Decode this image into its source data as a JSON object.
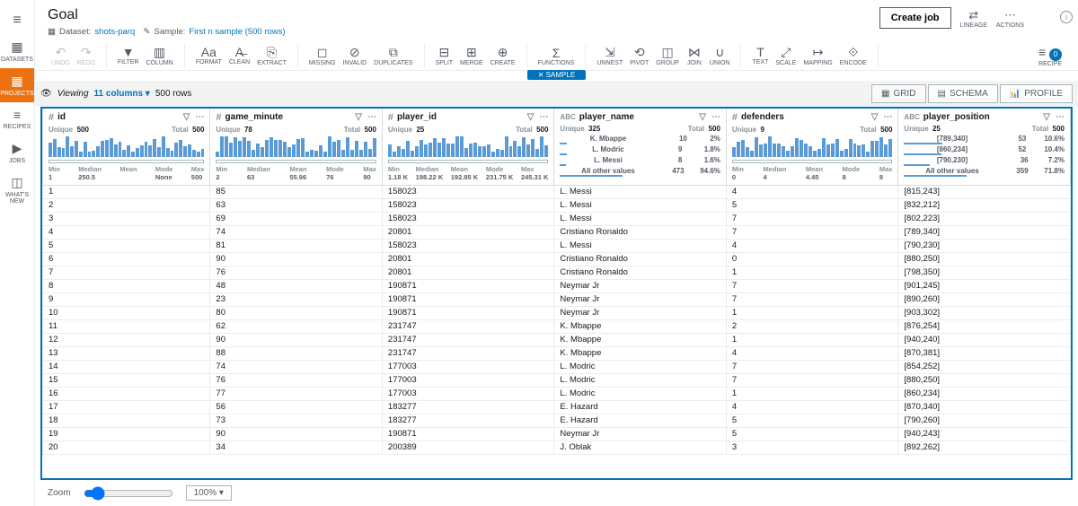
{
  "nav": {
    "items": [
      {
        "label": "DATASETS",
        "icon": "▦"
      },
      {
        "label": "PROJECTS",
        "icon": "▦"
      },
      {
        "label": "RECIPES",
        "icon": "≡"
      },
      {
        "label": "JOBS",
        "icon": "▶"
      },
      {
        "label": "WHAT'S NEW",
        "icon": "◫"
      }
    ]
  },
  "header": {
    "title": "Goal",
    "dataset_label": "Dataset:",
    "dataset_link": "shots-parq",
    "sample_label": "Sample:",
    "sample_link": "First n sample (500 rows)",
    "create_job": "Create job",
    "lineage": "LINEAGE",
    "actions": "ACTIONS"
  },
  "toolbar": {
    "undo": "UNDO",
    "redo": "REDO",
    "filter": "FILTER",
    "column": "COLUMN",
    "format": "FORMAT",
    "clean": "CLEAN",
    "extract": "EXTRACT",
    "missing": "MISSING",
    "invalid": "INVALID",
    "duplicates": "DUPLICATES",
    "split": "SPLIT",
    "merge": "MERGE",
    "create": "CREATE",
    "functions": "FUNCTIONS",
    "unnest": "UNNEST",
    "pivot": "PIVOT",
    "group": "GROUP",
    "join": "JOIN",
    "union": "UNION",
    "text": "TEXT",
    "scale": "SCALE",
    "mapping": "MAPPING",
    "encode": "ENCODE",
    "recipe": "RECIPE",
    "recipe_count": "0"
  },
  "sample_badge": "✕ SAMPLE",
  "viewrow": {
    "viewing": "Viewing",
    "columns": "11 columns",
    "rows": "500 rows",
    "grid": "GRID",
    "schema": "SCHEMA",
    "profile": "PROFILE"
  },
  "columns": {
    "id": {
      "name": "id",
      "type": "#",
      "unique": "500",
      "total": "500",
      "stats": {
        "Min": "1",
        "Median": "250.5",
        "Mean": "",
        "Mode": "None",
        "Max": "500"
      }
    },
    "game_minute": {
      "name": "game_minute",
      "type": "#",
      "unique": "78",
      "total": "500",
      "stats": {
        "Min": "2",
        "Median": "63",
        "Mean": "55.96",
        "Mode": "76",
        "Max": "90"
      }
    },
    "player_id": {
      "name": "player_id",
      "type": "#",
      "unique": "25",
      "total": "500",
      "stats": {
        "Min": "1.18 K",
        "Median": "198.22 K",
        "Mean": "192.85 K",
        "Mode": "231.75 K",
        "Max": "245.31 K"
      }
    },
    "player_name": {
      "name": "player_name",
      "type": "ABC",
      "unique": "325",
      "total": "500",
      "top": [
        {
          "v": "K. Mbappe",
          "c": "10",
          "p": "2%"
        },
        {
          "v": "L. Modric",
          "c": "9",
          "p": "1.8%"
        },
        {
          "v": "L. Messi",
          "c": "8",
          "p": "1.6%"
        },
        {
          "v": "All other values",
          "c": "473",
          "p": "94.6%"
        }
      ]
    },
    "defenders": {
      "name": "defenders",
      "type": "#",
      "unique": "9",
      "total": "500",
      "stats": {
        "Min": "0",
        "Median": "4",
        "Mean": "4.45",
        "Mode": "8",
        "Max": "8"
      }
    },
    "player_position": {
      "name": "player_position",
      "type": "ABC",
      "unique": "25",
      "total": "500",
      "top": [
        {
          "v": "[789,340]",
          "c": "53",
          "p": "10.6%"
        },
        {
          "v": "[860,234]",
          "c": "52",
          "p": "10.4%"
        },
        {
          "v": "[790,230]",
          "c": "36",
          "p": "7.2%"
        },
        {
          "v": "All other values",
          "c": "359",
          "p": "71.8%"
        }
      ]
    }
  },
  "labels": {
    "unique": "Unique",
    "total": "Total"
  },
  "rows": [
    {
      "id": "1",
      "gm": "85",
      "pid": "158023",
      "pn": "L. Messi",
      "def": "4",
      "pp": "[815,243]"
    },
    {
      "id": "2",
      "gm": "63",
      "pid": "158023",
      "pn": "L. Messi",
      "def": "5",
      "pp": "[832,212]"
    },
    {
      "id": "3",
      "gm": "69",
      "pid": "158023",
      "pn": "L. Messi",
      "def": "7",
      "pp": "[802,223]"
    },
    {
      "id": "4",
      "gm": "74",
      "pid": "20801",
      "pn": "Cristiano Ronaldo",
      "def": "7",
      "pp": "[789,340]"
    },
    {
      "id": "5",
      "gm": "81",
      "pid": "158023",
      "pn": "L. Messi",
      "def": "4",
      "pp": "[790,230]"
    },
    {
      "id": "6",
      "gm": "90",
      "pid": "20801",
      "pn": "Cristiano Ronaldo",
      "def": "0",
      "pp": "[880,250]"
    },
    {
      "id": "7",
      "gm": "76",
      "pid": "20801",
      "pn": "Cristiano Ronaldo",
      "def": "1",
      "pp": "[798,350]"
    },
    {
      "id": "8",
      "gm": "48",
      "pid": "190871",
      "pn": "Neymar Jr",
      "def": "7",
      "pp": "[901,245]"
    },
    {
      "id": "9",
      "gm": "23",
      "pid": "190871",
      "pn": "Neymar Jr",
      "def": "7",
      "pp": "[890,260]"
    },
    {
      "id": "10",
      "gm": "80",
      "pid": "190871",
      "pn": "Neymar Jr",
      "def": "1",
      "pp": "[903,302]"
    },
    {
      "id": "11",
      "gm": "62",
      "pid": "231747",
      "pn": "K. Mbappe",
      "def": "2",
      "pp": "[876,254]"
    },
    {
      "id": "12",
      "gm": "90",
      "pid": "231747",
      "pn": "K. Mbappe",
      "def": "1",
      "pp": "[940,240]"
    },
    {
      "id": "13",
      "gm": "88",
      "pid": "231747",
      "pn": "K. Mbappe",
      "def": "4",
      "pp": "[870,381]"
    },
    {
      "id": "14",
      "gm": "74",
      "pid": "177003",
      "pn": "L. Modric",
      "def": "7",
      "pp": "[854,252]"
    },
    {
      "id": "15",
      "gm": "76",
      "pid": "177003",
      "pn": "L. Modric",
      "def": "7",
      "pp": "[880,250]"
    },
    {
      "id": "16",
      "gm": "77",
      "pid": "177003",
      "pn": "L. Modric",
      "def": "1",
      "pp": "[860,234]"
    },
    {
      "id": "17",
      "gm": "56",
      "pid": "183277",
      "pn": "E. Hazard",
      "def": "4",
      "pp": "[870,340]"
    },
    {
      "id": "18",
      "gm": "73",
      "pid": "183277",
      "pn": "E. Hazard",
      "def": "5",
      "pp": "[790,260]"
    },
    {
      "id": "19",
      "gm": "90",
      "pid": "190871",
      "pn": "Neymar Jr",
      "def": "5",
      "pp": "[940,243]"
    },
    {
      "id": "20",
      "gm": "34",
      "pid": "200389",
      "pn": "J. Oblak",
      "def": "3",
      "pp": "[892,262]"
    }
  ],
  "footer": {
    "zoom": "Zoom",
    "zoom_value": "100% ▾"
  }
}
